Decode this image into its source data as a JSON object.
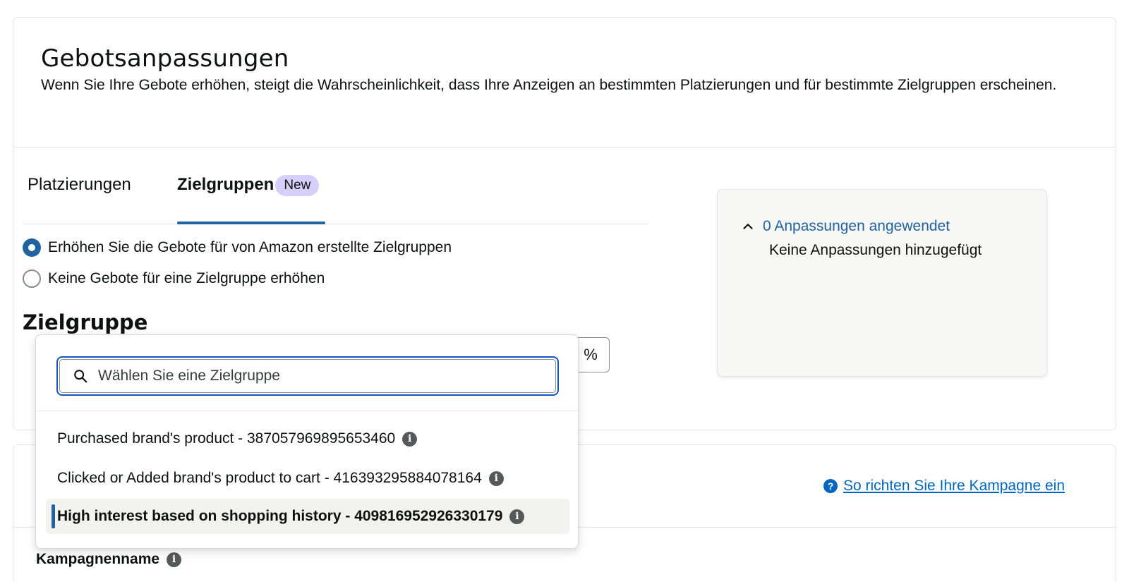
{
  "header": {
    "title": "Gebotsanpassungen",
    "description": "Wenn Sie Ihre Gebote erhöhen, steigt die Wahrscheinlichkeit, dass Ihre Anzeigen an bestimmten Platzierungen und für bestimmte Zielgruppen erscheinen."
  },
  "tabs": [
    {
      "label": "Platzierungen",
      "active": false
    },
    {
      "label": "Zielgruppen",
      "active": true,
      "badge": "New"
    }
  ],
  "radio_options": [
    {
      "label": "Erhöhen Sie die Gebote für von Amazon erstellte Zielgruppen",
      "checked": true
    },
    {
      "label": "Keine Gebote für eine Zielgruppe erhöhen",
      "checked": false
    }
  ],
  "audience_section": {
    "title": "Zielgruppe",
    "percent_suffix": "%"
  },
  "dropdown": {
    "search_placeholder": "Wählen Sie eine Zielgruppe",
    "items": [
      {
        "label": "Purchased brand's product - 387057969895653460",
        "highlighted": false
      },
      {
        "label": "Clicked or Added brand's product to cart - 416393295884078164",
        "highlighted": false
      },
      {
        "label": "High interest based on shopping history - 409816952926330179",
        "highlighted": true
      }
    ]
  },
  "summary": {
    "toggle_label": "0 Anpassungen angewendet",
    "empty_text": "Keine Anpassungen hinzugefügt"
  },
  "campaign": {
    "help_link": "So richten Sie Ihre Kampagne ein",
    "name_label": "Kampagnenname"
  },
  "colors": {
    "accent": "#2162a1",
    "link": "#0066c0",
    "badge_bg": "#d6cffa",
    "focus_border": "#1656c0"
  }
}
